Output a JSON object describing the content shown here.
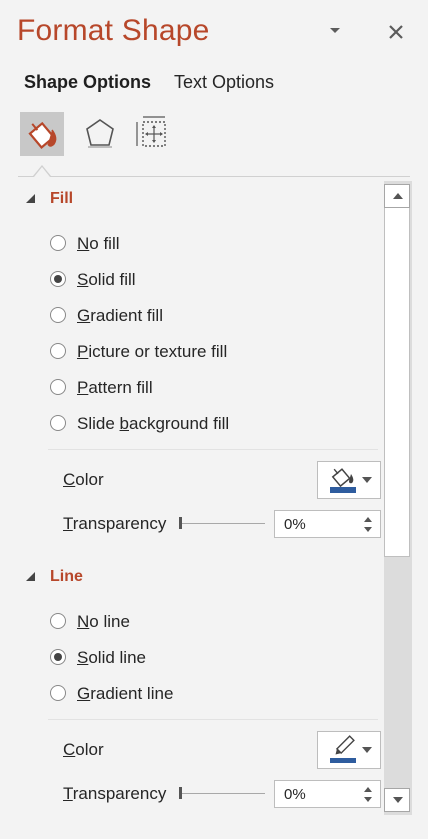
{
  "header": {
    "title": "Format Shape"
  },
  "tabs": [
    {
      "label": "Shape Options",
      "active": true
    },
    {
      "label": "Text Options",
      "active": false
    }
  ],
  "categories": [
    {
      "icon": "fill-line-icon",
      "selected": true
    },
    {
      "icon": "effects-pentagon-icon",
      "selected": false
    },
    {
      "icon": "size-properties-icon",
      "selected": false
    }
  ],
  "fill": {
    "title": "Fill",
    "options": [
      {
        "pre": "",
        "key": "N",
        "post": "o fill",
        "checked": false
      },
      {
        "pre": "",
        "key": "S",
        "post": "olid fill",
        "checked": true
      },
      {
        "pre": "",
        "key": "G",
        "post": "radient fill",
        "checked": false
      },
      {
        "pre": "",
        "key": "P",
        "post": "icture or texture fill",
        "checked": false
      },
      {
        "pre": "",
        "key": "P",
        "post": "attern fill",
        "checked": false
      },
      {
        "pre": "Slide ",
        "key": "b",
        "post": "ackground fill",
        "checked": false
      }
    ],
    "color_label": {
      "key": "C",
      "post": "olor"
    },
    "transparency_label": {
      "key": "T",
      "post": "ransparency"
    },
    "transparency_value": "0%",
    "transparency_level": 0,
    "color": "#2e5c9e"
  },
  "line": {
    "title": "Line",
    "options": [
      {
        "pre": "",
        "key": "N",
        "post": "o line",
        "checked": false
      },
      {
        "pre": "",
        "key": "S",
        "post": "olid line",
        "checked": true
      },
      {
        "pre": "",
        "key": "G",
        "post": "radient line",
        "checked": false
      }
    ],
    "color_label": {
      "key": "C",
      "post": "olor"
    },
    "transparency_label": {
      "key": "T",
      "post": "ransparency"
    },
    "transparency_value": "0%",
    "transparency_level": 0,
    "color": "#2e5c9e"
  },
  "colors": {
    "accent": "#b7472a",
    "background": "#f3f3f3"
  }
}
